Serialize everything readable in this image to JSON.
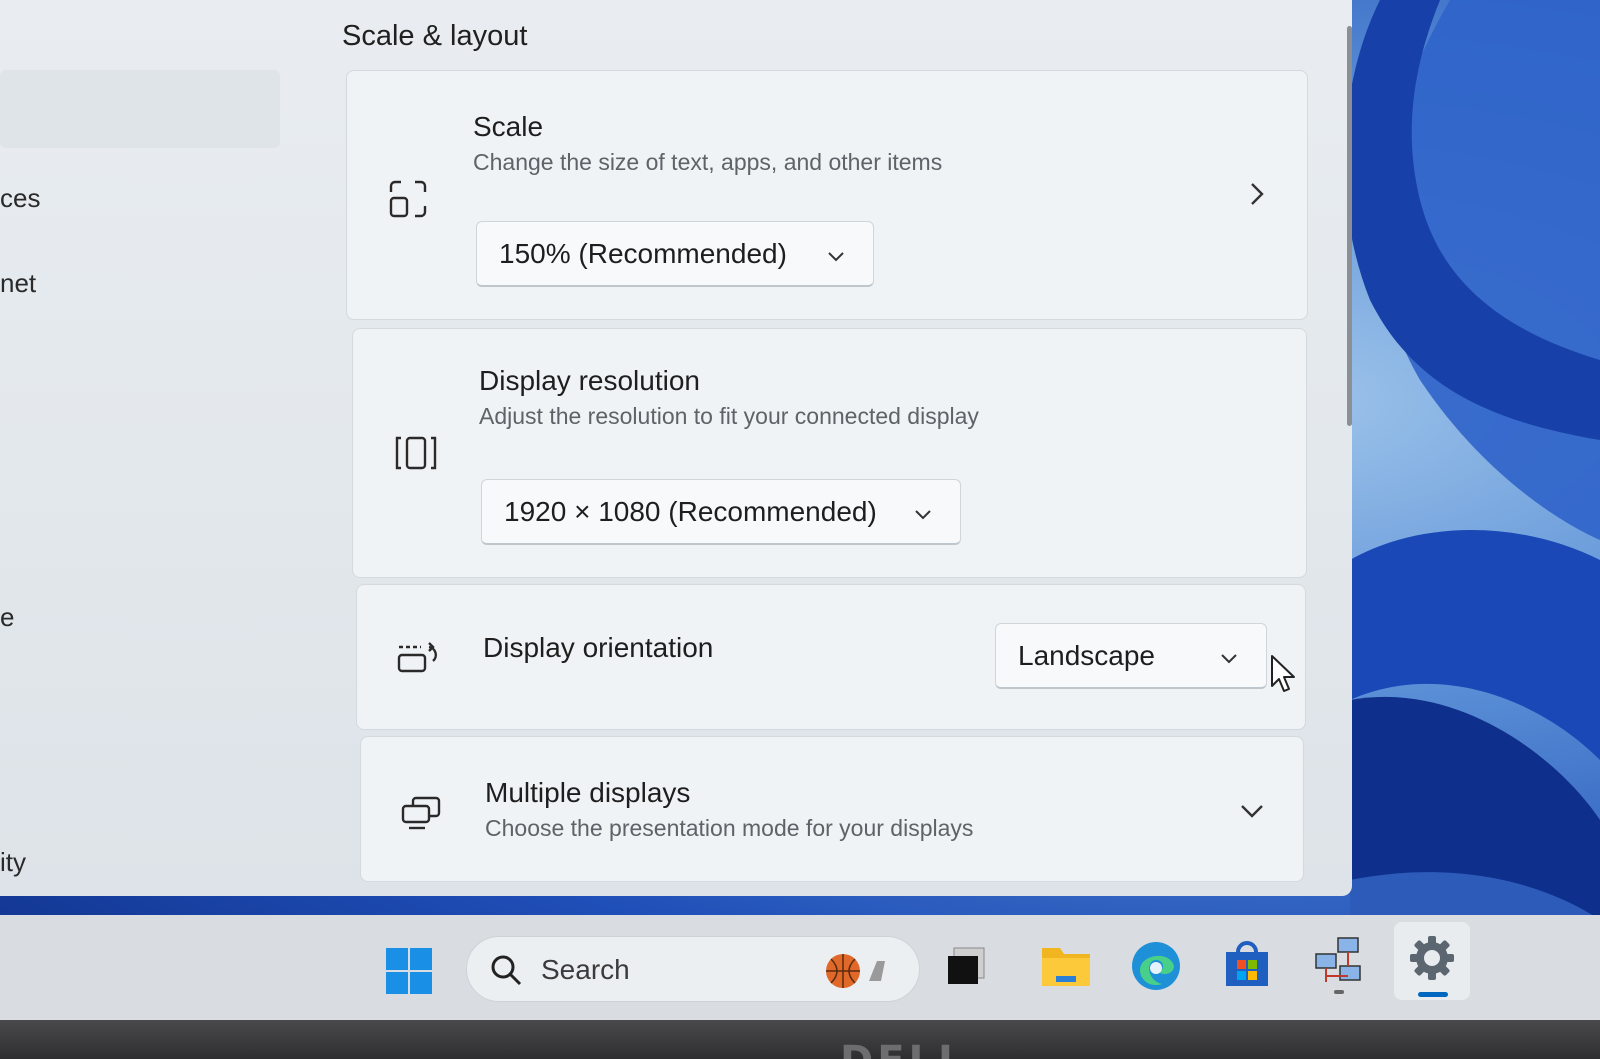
{
  "nav": {
    "items": [
      "ces",
      "net",
      "e",
      "ity"
    ]
  },
  "section": {
    "title": "Scale & layout"
  },
  "scale": {
    "title": "Scale",
    "description": "Change the size of text, apps, and other items",
    "value": "150% (Recommended)"
  },
  "resolution": {
    "title": "Display resolution",
    "description": "Adjust the resolution to fit your connected display",
    "value": "1920 × 1080 (Recommended)"
  },
  "orientation": {
    "title": "Display orientation",
    "value": "Landscape"
  },
  "multiple": {
    "title": "Multiple displays",
    "description": "Choose the presentation mode for your displays"
  },
  "taskbar": {
    "search_label": "Search",
    "icons": [
      "windows-start-icon",
      "search-icon",
      "basketball-icon",
      "task-view-icon",
      "file-explorer-icon",
      "edge-icon",
      "store-icon",
      "network-app-icon",
      "settings-gear-icon"
    ]
  },
  "bezel": {
    "logo": "DELL"
  },
  "colors": {
    "accent": "#0067c0",
    "card": "#f0f3f5",
    "window": "#e9edf1"
  }
}
